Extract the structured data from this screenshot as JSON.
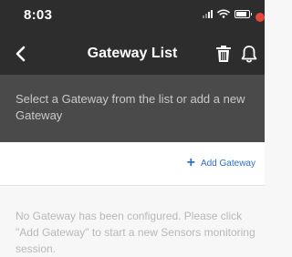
{
  "status_bar": {
    "time": "8:03"
  },
  "header": {
    "title": "Gateway List"
  },
  "hint": {
    "text": "Select a Gateway from the list or add a new Gateway"
  },
  "actions": {
    "add_gateway_icon": "+",
    "add_gateway_label": "Add Gateway"
  },
  "empty_state": {
    "message": "No Gateway has been configured. Please click \"Add Gateway\" to start a new Sensors monitoring session."
  },
  "icons": {
    "back": "chevron-left-icon",
    "delete": "trash-icon",
    "notifications": "bell-icon"
  },
  "colors": {
    "header_bg": "#2d2d2d",
    "hint_bg": "#4a4a4a",
    "accent": "#2f6fc9",
    "badge": "#e8453c"
  }
}
